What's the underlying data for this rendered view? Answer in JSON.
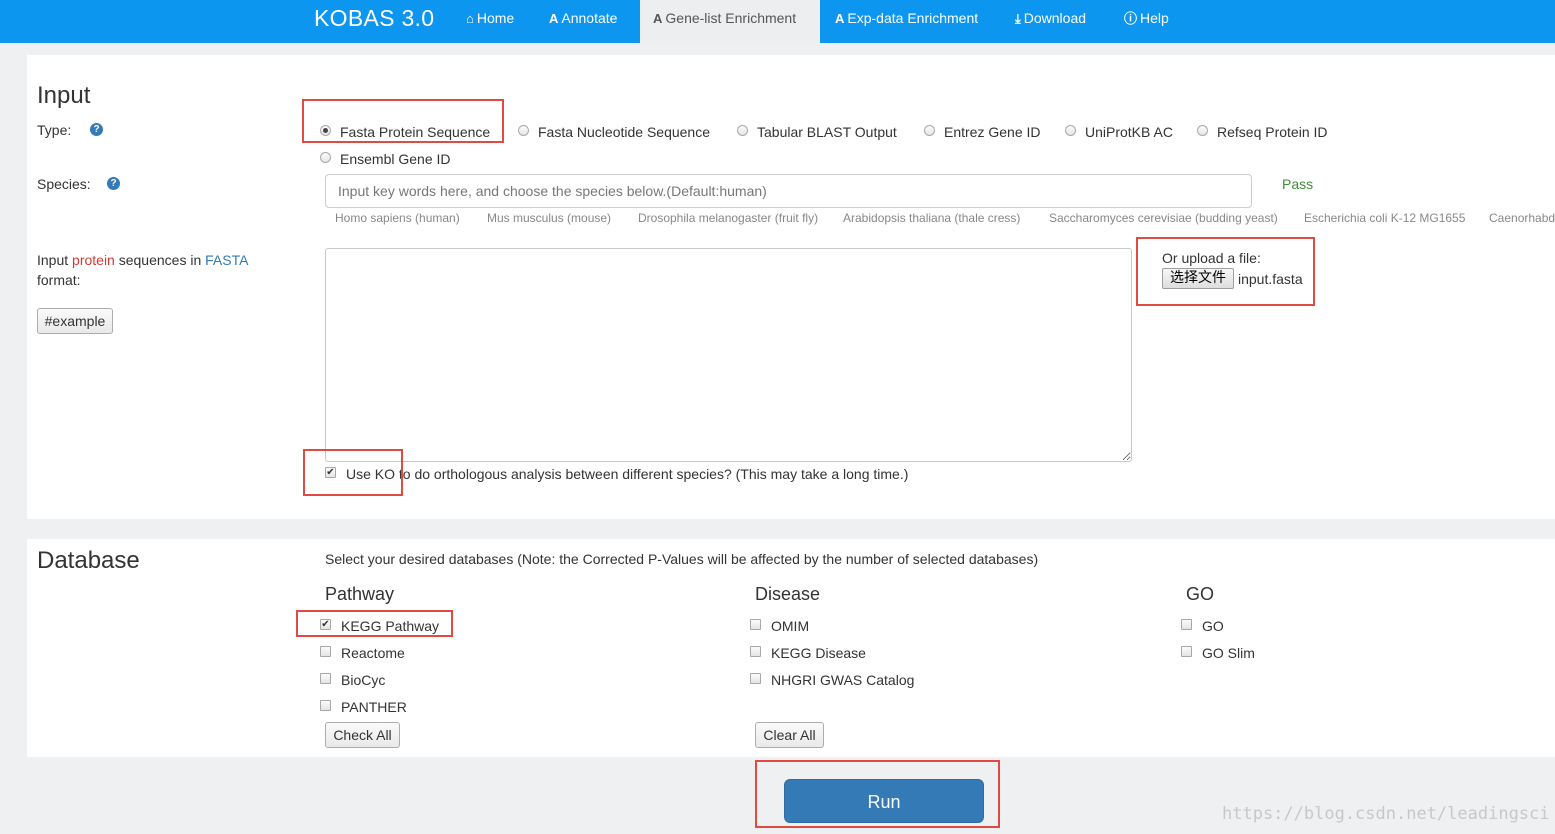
{
  "navbar": {
    "brand": "KOBAS 3.0",
    "items": [
      {
        "label": "Home",
        "icon": "home-icon"
      },
      {
        "label": "Annotate",
        "icon": "annotate-icon"
      },
      {
        "label": "Gene-list Enrichment",
        "icon": "enrichment-icon",
        "active": true
      },
      {
        "label": "Exp-data Enrichment",
        "icon": "exp-icon"
      },
      {
        "label": "Download",
        "icon": "download-icon"
      },
      {
        "label": "Help",
        "icon": "info-icon"
      }
    ]
  },
  "input": {
    "heading": "Input",
    "type_label": "Type:",
    "types": [
      {
        "label": "Fasta Protein Sequence",
        "checked": true
      },
      {
        "label": "Fasta Nucleotide Sequence",
        "checked": false
      },
      {
        "label": "Tabular BLAST Output",
        "checked": false
      },
      {
        "label": "Entrez Gene ID",
        "checked": false
      },
      {
        "label": "UniProtKB AC",
        "checked": false
      },
      {
        "label": "Refseq Protein ID",
        "checked": false
      },
      {
        "label": "Ensembl Gene ID",
        "checked": false
      }
    ],
    "species_label": "Species:",
    "species_placeholder": "Input key words here, and choose the species below.(Default:human)",
    "species_status": "Pass",
    "species_options": [
      "Homo sapiens (human)",
      "Mus musculus (mouse)",
      "Drosophila melanogaster (fruit fly)",
      "Arabidopsis thaliana (thale cress)",
      "Saccharomyces cerevisiae (budding yeast)",
      "Escherichia coli K-12 MG1655",
      "Caenorhabd"
    ],
    "seq_label_prefix": "Input ",
    "seq_label_protein": "protein",
    "seq_label_middle": " sequences in ",
    "seq_label_fasta": "FASTA",
    "seq_label_suffix": "format:",
    "example_button": "#example",
    "upload_label": "Or upload a file:",
    "file_button": "选择文件",
    "file_name": "input.fasta",
    "ko_option": {
      "label": "Use KO to do orthologous analysis between different species? (This may take a long time.)",
      "checked": true
    }
  },
  "database": {
    "heading": "Database",
    "note": "Select your desired databases (Note: the Corrected P-Values will be affected by the number of selected databases)",
    "columns": [
      {
        "title": "Pathway",
        "items": [
          {
            "label": "KEGG Pathway",
            "checked": true
          },
          {
            "label": "Reactome",
            "checked": false
          },
          {
            "label": "BioCyc",
            "checked": false
          },
          {
            "label": "PANTHER",
            "checked": false
          }
        ]
      },
      {
        "title": "Disease",
        "items": [
          {
            "label": "OMIM",
            "checked": false
          },
          {
            "label": "KEGG Disease",
            "checked": false
          },
          {
            "label": "NHGRI GWAS Catalog",
            "checked": false
          }
        ]
      },
      {
        "title": "GO",
        "items": [
          {
            "label": "GO",
            "checked": false
          },
          {
            "label": "GO Slim",
            "checked": false
          }
        ]
      }
    ],
    "check_all": "Check All",
    "clear_all": "Clear All"
  },
  "run_button": "Run",
  "watermark": "https://blog.csdn.net/leadingsci",
  "colors": {
    "navbar": "#0d96f0",
    "primary": "#337ab7",
    "highlight": "#e04a43",
    "pass": "#3c8e3c"
  }
}
